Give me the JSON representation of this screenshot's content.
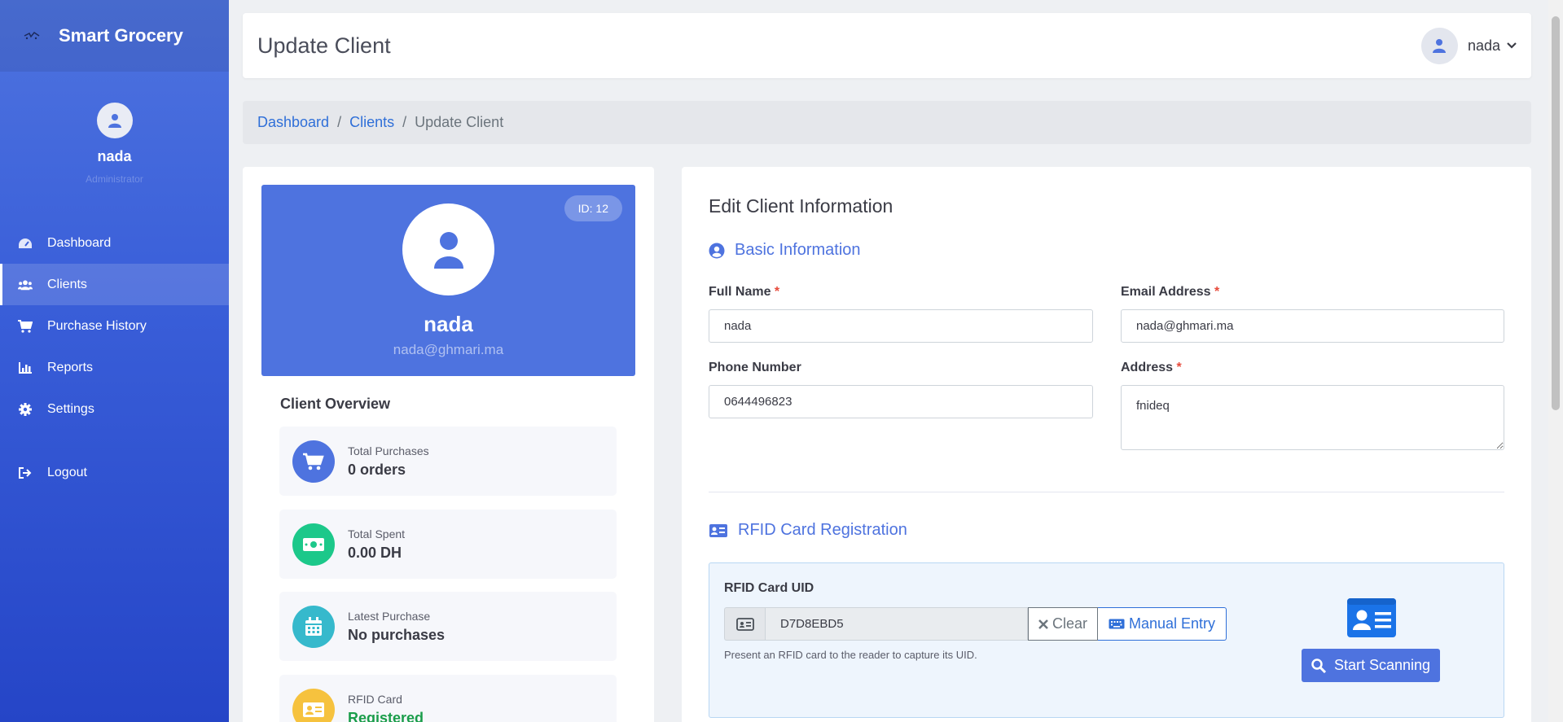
{
  "brand": {
    "name": "Smart Grocery"
  },
  "sidebar": {
    "user": {
      "name": "nada",
      "role": "Administrator"
    },
    "items": [
      {
        "label": "Dashboard",
        "icon": "tachometer-icon",
        "active": false
      },
      {
        "label": "Clients",
        "icon": "users-icon",
        "active": true
      },
      {
        "label": "Purchase History",
        "icon": "cart-icon",
        "active": false
      },
      {
        "label": "Reports",
        "icon": "bar-chart-icon",
        "active": false
      },
      {
        "label": "Settings",
        "icon": "gear-icon",
        "active": false
      }
    ],
    "logout": "Logout"
  },
  "header": {
    "title": "Update Client",
    "user": "nada"
  },
  "breadcrumb": {
    "items": [
      "Dashboard",
      "Clients"
    ],
    "current": "Update Client"
  },
  "profile_card": {
    "id_badge": "ID: 12",
    "name": "nada",
    "email": "nada@ghmari.ma",
    "overview_title": "Client Overview",
    "stats": [
      {
        "label": "Total Purchases",
        "value": "0 orders",
        "color": "#4e73df",
        "icon": "cart-icon"
      },
      {
        "label": "Total Spent",
        "value": "0.00 DH",
        "color": "#1cc88a",
        "icon": "money-icon"
      },
      {
        "label": "Latest Purchase",
        "value": "No purchases",
        "color": "#36b9cc",
        "icon": "calendar-icon"
      },
      {
        "label": "RFID Card",
        "value": "Registered",
        "color": "#f6c23e",
        "icon": "id-card-icon"
      }
    ]
  },
  "form": {
    "title": "Edit Client Information",
    "basic_section": "Basic Information",
    "full_name": {
      "label": "Full Name",
      "required": "*",
      "value": "nada"
    },
    "email": {
      "label": "Email Address",
      "required": "*",
      "value": "nada@ghmari.ma"
    },
    "phone": {
      "label": "Phone Number",
      "value": "0644496823"
    },
    "address": {
      "label": "Address",
      "required": "*",
      "value": "fnideq"
    },
    "rfid_section": "RFID Card Registration",
    "rfid": {
      "label": "RFID Card UID",
      "value": "D7D8EBD5",
      "clear_label": "Clear",
      "manual_label": "Manual Entry",
      "help": "Present an RFID card to the reader to capture its UID.",
      "scan_label": "Start Scanning"
    }
  },
  "colors": {
    "primary": "#4e73df",
    "success": "#1cc88a",
    "info": "#36b9cc",
    "warning": "#f6c23e",
    "danger": "#e74a3b",
    "link": "#2f6fd8"
  }
}
